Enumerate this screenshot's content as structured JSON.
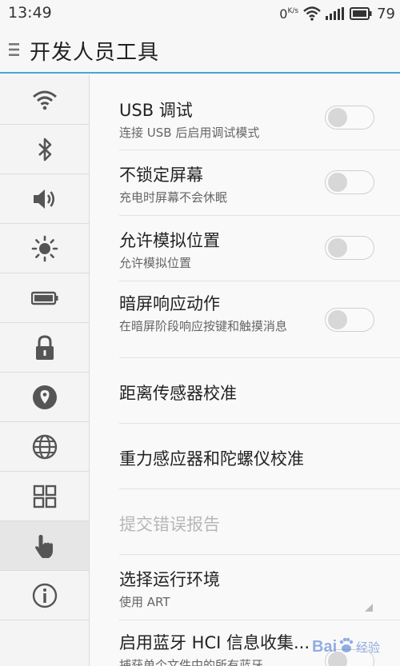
{
  "status_bar": {
    "time": "13:49",
    "net_speed_value": "0",
    "net_speed_unit": "K/s",
    "battery_level": "79"
  },
  "header": {
    "title": "开发人员工具"
  },
  "sidebar": {
    "items": [
      {
        "icon": "wifi-icon"
      },
      {
        "icon": "bluetooth-icon"
      },
      {
        "icon": "volume-icon"
      },
      {
        "icon": "brightness-icon"
      },
      {
        "icon": "battery-icon"
      },
      {
        "icon": "lock-icon"
      },
      {
        "icon": "location-icon"
      },
      {
        "icon": "globe-icon"
      },
      {
        "icon": "apps-grid-icon"
      },
      {
        "icon": "hand-pointer-icon",
        "active": true
      },
      {
        "icon": "info-icon"
      }
    ]
  },
  "settings": [
    {
      "title": "USB 调试",
      "subtitle": "连接 USB 后启用调试模式",
      "control": "toggle",
      "on": false
    },
    {
      "title": "不锁定屏幕",
      "subtitle": "充电时屏幕不会休眠",
      "control": "toggle",
      "on": false
    },
    {
      "title": "允许模拟位置",
      "subtitle": "允许模拟位置",
      "control": "toggle",
      "on": false
    },
    {
      "title": "暗屏响应动作",
      "subtitle": "在暗屏阶段响应按键和触摸消息",
      "control": "toggle",
      "on": false
    },
    {
      "title": "距离传感器校准"
    },
    {
      "title": "重力感应器和陀螺仪校准"
    },
    {
      "title": "提交错误报告",
      "disabled": true
    },
    {
      "title": "选择运行环境",
      "subtitle": "使用 ART",
      "control": "dropdown"
    },
    {
      "title": "启用蓝牙 HCI 信息收集...",
      "subtitle": "捕获单个文件中的所有蓝牙",
      "control": "toggle",
      "on": false
    }
  ],
  "watermark": {
    "brand": "Bai",
    "suffix": "经验"
  },
  "colors": {
    "accent_line": "#48a6d6",
    "icon_gray": "#555555"
  }
}
